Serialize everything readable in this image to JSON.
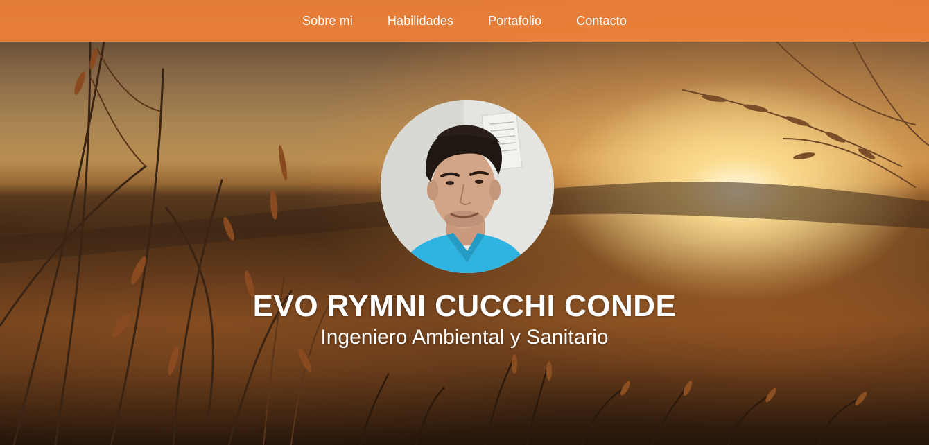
{
  "nav": {
    "items": [
      {
        "label": "Sobre mi"
      },
      {
        "label": "Habilidades"
      },
      {
        "label": "Portafolio"
      },
      {
        "label": "Contacto"
      }
    ]
  },
  "hero": {
    "name": "EVO RYMNI CUCCHI CONDE",
    "title": "Ingeniero Ambiental y Sanitario",
    "background": "sunset-grass-field-photo",
    "avatar": "profile-photo"
  },
  "colors": {
    "nav_background": "#f0823a",
    "text": "#ffffff",
    "shirt": "#2fb3e0"
  }
}
